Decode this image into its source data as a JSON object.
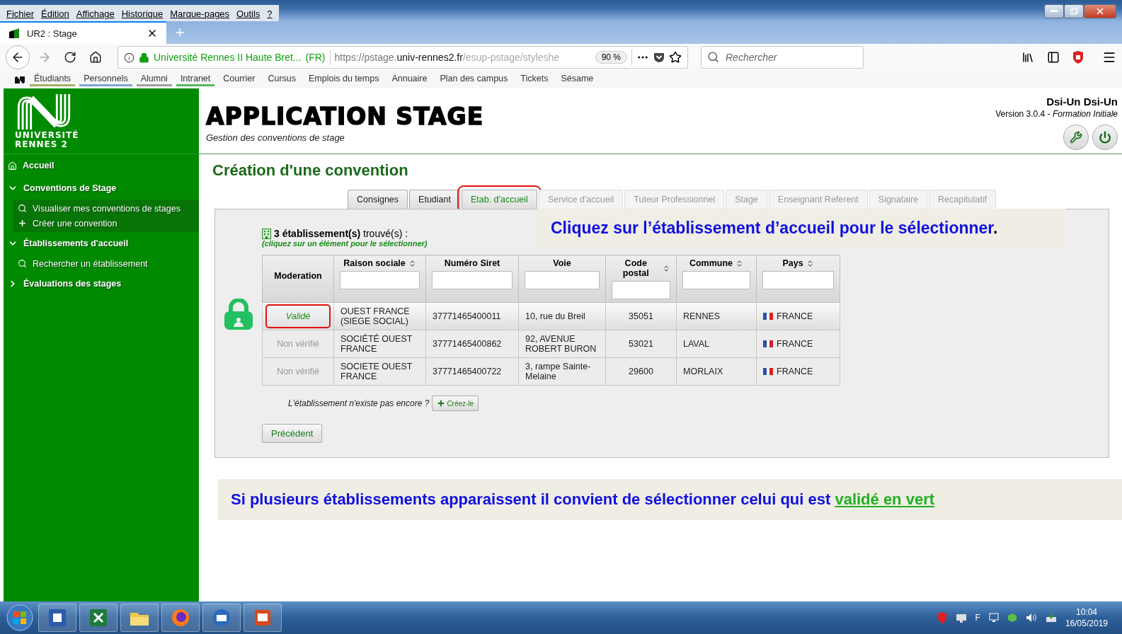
{
  "browser": {
    "menu": [
      "Fichier",
      "Édition",
      "Affichage",
      "Historique",
      "Marque-pages",
      "Outils",
      "?"
    ],
    "tab": {
      "title": "UR2 : Stage"
    },
    "site": {
      "name": "Université Rennes II Haute Bret...",
      "country": "(FR)"
    },
    "address": [
      {
        "text": "https://pstage.",
        "kind": "dim"
      },
      {
        "text": "univ-rennes2.fr",
        "kind": "host"
      },
      {
        "text": "/esup-pstage/styleshe",
        "kind": "fade"
      }
    ],
    "zoom": "90 %",
    "search": {
      "placeholder": "Rechercher"
    },
    "bookmarks": [
      {
        "label": "Étudiants",
        "color": "#a8b060"
      },
      {
        "label": "Personnels",
        "color": "#7ea6d8"
      },
      {
        "label": "Alumni",
        "color": "#a0a0a0"
      },
      {
        "label": "Intranet",
        "color": "#5cb85c"
      },
      {
        "label": "Courrier"
      },
      {
        "label": "Cursus"
      },
      {
        "label": "Emplois du temps"
      },
      {
        "label": "Annuaire"
      },
      {
        "label": "Plan des campus"
      },
      {
        "label": "Tickets"
      },
      {
        "label": "Sésame"
      }
    ]
  },
  "sidebar": {
    "logo": [
      "UNIVERSITÉ",
      "RENNES 2"
    ],
    "items": [
      {
        "label": "Accueil",
        "kind": "home"
      },
      {
        "label": "Conventions de Stage",
        "kind": "group",
        "expanded": true,
        "children": [
          {
            "label": "Visualiser mes conventions de stages",
            "kind": "search"
          },
          {
            "label": "Créer une convention",
            "kind": "add"
          }
        ]
      },
      {
        "label": "Établissements d'accueil",
        "kind": "group",
        "expanded": true,
        "children": [
          {
            "label": "Rechercher un établissement",
            "kind": "search"
          }
        ]
      },
      {
        "label": "Évaluations des stages",
        "kind": "group",
        "expanded": false
      }
    ]
  },
  "header": {
    "title": "APPLICATION STAGE",
    "subtitle": "Gestion des conventions de stage",
    "user": "Dsi-Un Dsi-Un",
    "version": "Version 3.0.4 - *Formation Initiale*"
  },
  "page": {
    "title": "Création d'une convention",
    "steps": [
      {
        "label": "Consignes",
        "selected": false,
        "disabled": false,
        "annotated": false
      },
      {
        "label": "Etudiant",
        "selected": false,
        "disabled": false,
        "annotated": false
      },
      {
        "label": "Etab. d'accueil",
        "selected": true,
        "disabled": false,
        "annotated": true
      },
      {
        "label": "Service d'accueil",
        "selected": false,
        "disabled": true,
        "annotated": false
      },
      {
        "label": "Tuteur Professionnel",
        "selected": false,
        "disabled": true,
        "annotated": false
      },
      {
        "label": "Stage",
        "selected": false,
        "disabled": true,
        "annotated": false
      },
      {
        "label": "Enseignant Referent",
        "selected": false,
        "disabled": true,
        "annotated": false
      },
      {
        "label": "Signataire",
        "selected": false,
        "disabled": true,
        "annotated": false
      },
      {
        "label": "Recapitulatif",
        "selected": false,
        "disabled": true,
        "annotated": false
      }
    ],
    "callout_top": {
      "text": "Cliquez sur l’établissement d’accueil pour le sélectionner",
      "end": "."
    },
    "results": {
      "count": "**3 établissement(s)** trouvé(s) :",
      "hint": "(cliquez sur un élément pour le sélectionner)"
    },
    "table": {
      "columns": [
        {
          "label": "Moderation",
          "sortable": false,
          "filter": false
        },
        {
          "label": "Raison sociale",
          "sortable": true,
          "filter": true
        },
        {
          "label": "Numéro Siret",
          "sortable": false,
          "filter": true
        },
        {
          "label": "Voie",
          "sortable": false,
          "filter": true
        },
        {
          "label": "Code postal",
          "sortable": true,
          "filter": true
        },
        {
          "label": "Commune",
          "sortable": true,
          "filter": true
        },
        {
          "label": "Pays",
          "sortable": true,
          "filter": true
        }
      ],
      "rows": [
        {
          "selected": true,
          "validated": true,
          "annotated": true,
          "cells": [
            "Validé",
            "OUEST FRANCE (SIEGE SOCIAL)",
            "37771465400011",
            "10, rue du Breil",
            "35051",
            "RENNES",
            "FRANCE"
          ]
        },
        {
          "selected": false,
          "validated": false,
          "annotated": false,
          "cells": [
            "Non vérifié",
            "SOCIÉTÉ OUEST FRANCE",
            "37771465400862",
            "92, AVENUE ROBERT BURON",
            "53021",
            "LAVAL",
            "FRANCE"
          ]
        },
        {
          "selected": false,
          "validated": false,
          "annotated": false,
          "cells": [
            "Non vérifié",
            "SOCIETE OUEST FRANCE",
            "37771465400722",
            "3, rampe Sainte-Melaine",
            "29600",
            "MORLAIX",
            "FRANCE"
          ]
        }
      ]
    },
    "create": {
      "question": "L'établissement n'existe pas encore ?",
      "button": "Créez-le"
    },
    "back_button": "Précédent",
    "callout_bottom": {
      "text": "Si plusieurs établissements apparaissent il convient de sélectionner celui qui est ",
      "link": "validé en vert"
    }
  },
  "taskbar": {
    "tray_label": "F",
    "time": "10:04",
    "date": "16/05/2019"
  }
}
